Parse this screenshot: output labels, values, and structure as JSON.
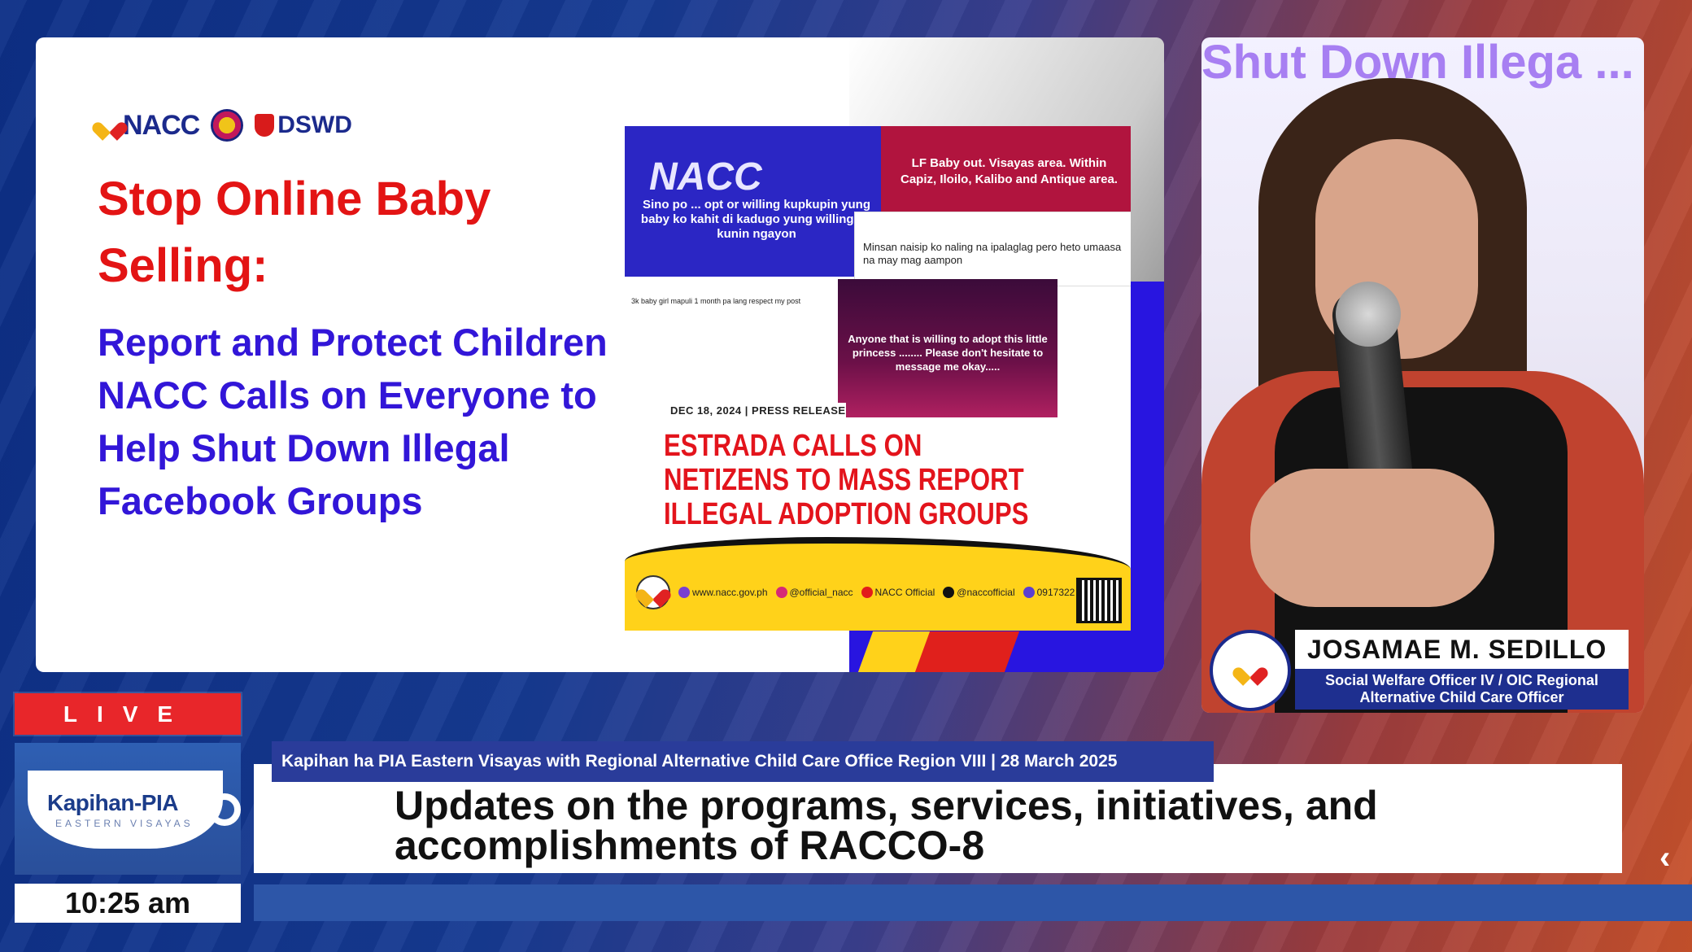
{
  "slide": {
    "logos": {
      "nacc": "NACC",
      "dswd": "DSWD"
    },
    "title": "Stop Online Baby Selling:",
    "subtitle": "Report and Protect Children NACC Calls on Everyone to Help Shut Down Illegal Facebook Groups"
  },
  "press_release": {
    "logo_text": "NACC",
    "top_left_text": "Sino po ... opt or willing kupkupin yung baby ko kahit di kadugo yung willing po kunin ngayon",
    "top_right_text": "LF Baby out. Visayas area. Within Capiz, Iloilo, Kalibo and Antique area.",
    "comment_card_text": "Minsan naisip ko naling na ipalaglag pero heto umaasa na may mag aampon",
    "post_text": "3k baby girl mapuli 1 month pa lang respect my post",
    "purple_card_text": "Anyone that is willing to adopt this little princess ........ Please don't hesitate to message me okay.....",
    "date": "DEC 18, 2024 | PRESS RELEASE",
    "headline": "ESTRADA CALLS ON NETIZENS TO MASS REPORT ILLEGAL ADOPTION GROUPS",
    "social": {
      "website": "www.nacc.gov.ph",
      "instagram": "@official_nacc",
      "youtube": "NACC Official",
      "tiktok": "@naccofficial",
      "phone": "0917322"
    }
  },
  "speaker": {
    "background_text": "Shut Down Illega ... oo ... ups",
    "name": "JOSAMAE M. SEDILLO",
    "role": "Social Welfare Officer IV / OIC Regional Alternative Child Care Officer"
  },
  "broadcast": {
    "live_label": "LIVE",
    "show_name": "Kapihan",
    "show_name_suffix": "PIA",
    "show_region": "EASTERN VISAYAS",
    "time": "10:25 am",
    "program_tag": "Kapihan ha PIA Eastern Visayas with Regional Alternative Child Care Office Region VIII  | 28 March 2025",
    "headline": "Updates on the programs, services, initiatives, and accomplishments of RACCO-8",
    "chevron": "‹"
  },
  "colors": {
    "live_red": "#e8262a",
    "slide_title_red": "#e31414",
    "slide_sub_blue": "#3216d8",
    "tag_blue": "#2a3c9a",
    "crawl_blue": "#2d56a8"
  }
}
